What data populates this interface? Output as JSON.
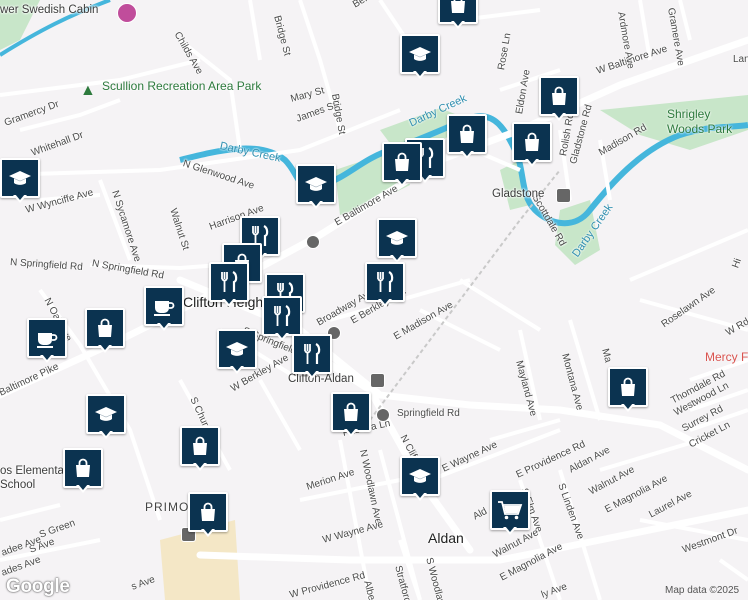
{
  "map": {
    "towns": {
      "clifton_heights": "Clifton Heights",
      "aldan": "Aldan",
      "primos": "PRIMOS"
    },
    "places": {
      "swedish_cabin": "wer Swedish Cabin",
      "scullion_park": "Scullion Recreation Area Park",
      "shrigley_park": "Shrigley Woods Park",
      "gladstone": "Gladstone",
      "clifton_aldan": "Clifton-Aldan",
      "primos_school": "os Elementary School",
      "mercy": "Mercy F"
    },
    "water": {
      "darby_creek_1": "Darby Creek",
      "darby_creek_2": "Darby Creek",
      "darby_creek_3": "Darby Creek"
    },
    "streets": {
      "childs_ave": "Childs Ave",
      "bridge_st_top": "Bridge St",
      "mary_st": "Mary St",
      "james_st": "James St",
      "bridge_st": "Bridge St",
      "berkley": "Berkley",
      "gramercy_dr": "Gramercy Dr",
      "whitehall_dr": "Whitehall Dr",
      "n_glenwood_ave": "N Glenwood Ave",
      "w_wynciffe_ave": "W Wynciffe Ave",
      "n_sycamore_ave": "N Sycamore Ave",
      "walnut_st": "Walnut St",
      "harrison_ave": "Harrison Ave",
      "n_springfield_rd": "N Springfield Rd",
      "e_baltimore_ave": "E Baltimore Ave",
      "w_baltimore_ave": "W Baltimore Ave",
      "rose_ln": "Rose Ln",
      "eldon_ave": "Eldon Ave",
      "ardmore_ave": "Ardmore Ave",
      "gramere_ave": "Gramere Ave",
      "lan": "Lan",
      "rolish_rd": "Rolish Rd",
      "gladstone_rd": "Gladstone Rd",
      "madison_rd": "Madison Rd",
      "scottdale_rd": "Scottdale Rd",
      "n_oak_ave": "N Oak Ave",
      "baltimore_pike": "Baltimore Pike",
      "broadway_ave": "Broadway Ave",
      "e_berkley_ave": "E Berkley Ave",
      "e_madison_ave": "E Madison Ave",
      "s_springfield": "S Springfield",
      "w_berkley_ave": "W Berkley Ave",
      "s_church_st": "S Church St",
      "roselawn_ave": "Roselawn Ave",
      "hi": "Hi",
      "mayland_ave": "Mayland Ave",
      "montana_ave": "Montana Ave",
      "ma": "Ma",
      "w_rd": "W Rd",
      "springfield_rd": "Springfield Rd",
      "priscilla_ln": "Priscilla Ln",
      "n_clifton": "N Clifton",
      "n_woodlawn_ave": "N Woodlawn Ave",
      "merion_ave": "Merion Ave",
      "e_wayne_ave": "E Wayne Ave",
      "w_wayne_ave": "W Wayne Ave",
      "e_providence_rd": "E Providence Rd",
      "thomdale_rd": "Thomdale Rd",
      "westwood_ln": "Westwood Ln",
      "surrey_rd": "Surrey Rd",
      "cricket_ln": "Cricket Ln",
      "aldan_ave": "Aldan Ave",
      "walnut_ave": "Walnut Ave",
      "e_magnolia_ave": "E Magnolia Ave",
      "laurel_ave": "Laurel Ave",
      "s_elm_ave": "S Elm Ave",
      "s_linden_ave": "S Linden Ave",
      "walnut_ave2": "Walnut Ave",
      "e_magnolia_ave2": "E Magnolia Ave",
      "westmont_dr": "Westmont Dr",
      "w_providence_rd": "W Providence Rd",
      "stratford_rd": "Stratford Rd",
      "s_woodlawn": "S Woodlaw",
      "albe": "Albe",
      "ald": "Ald",
      "s_green": "S Green",
      "s_ave": "S Ave",
      "ly_ave": "ly Ave",
      "s_ave2": "s Ave",
      "adee_ave": "adee Ave",
      "ades_ave": "ades Ave"
    },
    "attribution": "Map data ©2025",
    "logo": "Google",
    "colors": {
      "pin": "#0b3350",
      "park": "#c8e6c9",
      "water": "#45b6dc",
      "road": "#ffffff"
    },
    "pins": [
      {
        "kind": "shopping",
        "icon": "shopping-bag-icon"
      },
      {
        "kind": "school",
        "icon": "graduation-cap-icon"
      },
      {
        "kind": "shopping",
        "icon": "shopping-bag-icon"
      },
      {
        "kind": "shopping",
        "icon": "shopping-bag-icon"
      },
      {
        "kind": "shopping",
        "icon": "shopping-bag-icon"
      },
      {
        "kind": "restaurant",
        "icon": "fork-knife-icon"
      },
      {
        "kind": "shopping",
        "icon": "shopping-bag-icon"
      },
      {
        "kind": "school",
        "icon": "graduation-cap-icon"
      },
      {
        "kind": "school",
        "icon": "graduation-cap-icon"
      },
      {
        "kind": "school",
        "icon": "graduation-cap-icon"
      },
      {
        "kind": "restaurant",
        "icon": "fork-knife-icon"
      },
      {
        "kind": "shopping",
        "icon": "shopping-bag-icon"
      },
      {
        "kind": "restaurant",
        "icon": "fork-knife-icon"
      },
      {
        "kind": "restaurant",
        "icon": "fork-knife-icon"
      },
      {
        "kind": "restaurant",
        "icon": "fork-knife-icon"
      },
      {
        "kind": "cafe",
        "icon": "coffee-cup-icon"
      },
      {
        "kind": "cafe",
        "icon": "coffee-cup-icon"
      },
      {
        "kind": "shopping",
        "icon": "shopping-bag-icon"
      },
      {
        "kind": "restaurant",
        "icon": "fork-knife-icon"
      },
      {
        "kind": "restaurant",
        "icon": "fork-knife-icon"
      },
      {
        "kind": "shopping",
        "icon": "shopping-bag-icon"
      },
      {
        "kind": "school",
        "icon": "graduation-cap-icon"
      },
      {
        "kind": "shopping",
        "icon": "shopping-bag-icon"
      },
      {
        "kind": "school",
        "icon": "graduation-cap-icon"
      },
      {
        "kind": "school",
        "icon": "graduation-cap-icon"
      },
      {
        "kind": "shopping",
        "icon": "shopping-bag-icon"
      },
      {
        "kind": "grocery",
        "icon": "shopping-cart-icon"
      },
      {
        "kind": "shopping",
        "icon": "shopping-bag-icon"
      },
      {
        "kind": "shopping",
        "icon": "shopping-bag-icon"
      }
    ]
  }
}
